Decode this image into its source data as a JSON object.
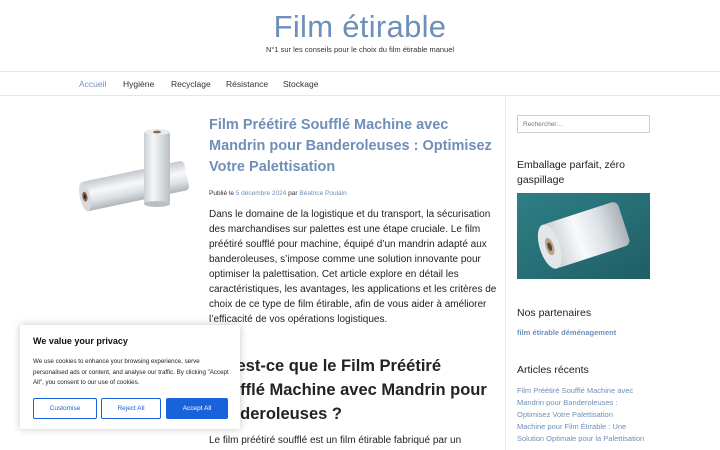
{
  "site": {
    "title": "Film étirable",
    "description": "N°1 sur les conseils pour le choix du film étirable manuel"
  },
  "nav": {
    "items": [
      {
        "label": "Accueil",
        "active": true
      },
      {
        "label": "Hygiène"
      },
      {
        "label": "Recyclage"
      },
      {
        "label": "Résistance"
      },
      {
        "label": "Stockage"
      }
    ]
  },
  "post": {
    "title": "Film Préétiré Soufflé Machine avec Mandrin pour Banderoleuses : Optimisez Votre Palettisation",
    "meta_published": "Publié le",
    "meta_date": "5 décembre 2024",
    "meta_by": "par",
    "meta_author": "Béatrice Poulain",
    "excerpt": "Dans le domaine de la logistique et du transport, la sécurisation des marchandises sur palettes est une étape cruciale. Le film préétiré soufflé pour machine, équipé d’un mandrin adapté aux banderoleuses, s’impose comme une solution innovante pour optimiser la palettisation. Cet article explore en détail les caractéristiques, les avantages, les applications et les critères de choix de ce type de film étirable, afin de vous aider à améliorer l’efficacité de vos opérations logistiques.",
    "heading": "Qu’est-ce que le Film Préétiré Soufflé Machine avec Mandrin pour Banderoleuses ?",
    "after_heading": "Le film préétiré soufflé est un film étirable fabriqué par un"
  },
  "sidebar": {
    "search_placeholder": "Rechercher…",
    "widget1_title": "Emballage parfait, zéro gaspillage",
    "widget2_title": "Nos partenaires",
    "partner_link": "film étirable déménagement",
    "widget3_title": "Articles récents",
    "recent": [
      "Film Préétiré Soufflé Machine avec Mandrin pour Banderoleuses : Optimisez Votre Palettisation",
      "Machine pour Film Étirable : Une Solution Optimale pour la Palettisation"
    ]
  },
  "cookie": {
    "title": "We value your privacy",
    "text": "We use cookies to enhance your browsing experience, serve personalised ads or content, and analyse our traffic. By clicking \"Accept All\", you consent to our use of cookies.",
    "customise": "Customise",
    "reject": "Reject All",
    "accept": "Accept All"
  },
  "colors": {
    "accent": "#6e8fb8",
    "cookie_button": "#1863dc"
  }
}
